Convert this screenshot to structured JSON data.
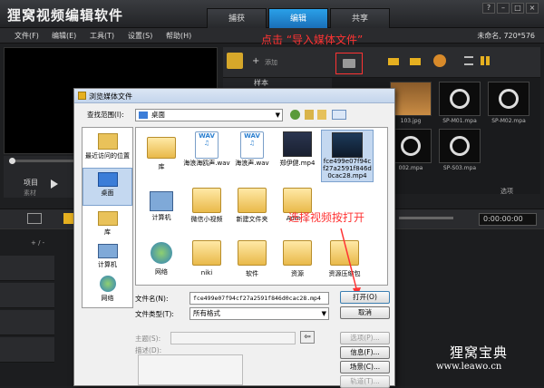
{
  "app": {
    "title": "狸窝视频编辑软件",
    "modes": [
      "捕获",
      "编辑",
      "共享"
    ],
    "active_mode": "编辑",
    "project_info": "未命名, 720*576"
  },
  "menu": [
    "文件(F)",
    "编辑(E)",
    "工具(T)",
    "设置(S)",
    "帮助(H)"
  ],
  "library": {
    "add_label": "添加",
    "sample_label": "样本",
    "options_label": "选项",
    "thumbs": [
      {
        "label": "103.jpg",
        "kind": "image"
      },
      {
        "label": "SP-M01.mpa",
        "kind": "audio"
      },
      {
        "label": "SP-M02.mpa",
        "kind": "audio"
      },
      {
        "label": "002.mpa",
        "kind": "audio"
      },
      {
        "label": "SP-S03.mpa",
        "kind": "audio"
      }
    ]
  },
  "player": {
    "project_label": "项目",
    "clip_label": "素材",
    "timecode": "0:00:00:00"
  },
  "timeline": {
    "timecode": "0:00:00:00",
    "ruler_label": "+ / -"
  },
  "dialog": {
    "title": "浏览媒体文件",
    "look_in_label": "查找范围(I):",
    "look_in_value": "桌面",
    "places": [
      "最近访问的位置",
      "桌面",
      "库",
      "计算机",
      "网络"
    ],
    "files": [
      {
        "name": "库",
        "type": "folder"
      },
      {
        "name": "海浪海鸥声.wav",
        "type": "wav"
      },
      {
        "name": "海浪声.wav",
        "type": "wav"
      },
      {
        "name": "郑伊健.mp4",
        "type": "video"
      },
      {
        "name": "fce499e07f94cf27a2591f846d0cac28.mp4",
        "type": "video-selected"
      },
      {
        "name": "计算机",
        "type": "computer"
      },
      {
        "name": "微信小视频",
        "type": "folder"
      },
      {
        "name": "新建文件夹",
        "type": "folder"
      },
      {
        "name": "Admi...",
        "type": "user"
      },
      {
        "name": "网络",
        "type": "network"
      },
      {
        "name": "niki",
        "type": "folder"
      },
      {
        "name": "软件",
        "type": "folder"
      },
      {
        "name": "资源",
        "type": "folder"
      },
      {
        "name": "资源压缩包",
        "type": "folder"
      }
    ],
    "filename_label": "文件名(N):",
    "filename_value": "fce499e07f94cf27a2591f846d0cac28.mp4",
    "filetype_label": "文件类型(T):",
    "filetype_value": "所有格式",
    "open_button": "打开(O)",
    "cancel_button": "取消",
    "subject_label": "主题(S):",
    "description_label": "描述(D):",
    "options_button": "选项(P)...",
    "info_button": "信息(F)...",
    "scene_button": "场景(C)...",
    "trim_button": "轨道(T)..."
  },
  "annotations": {
    "import_hint": "点击 “导入媒体文件”",
    "select_hint": "选择视频按打开"
  },
  "watermark": {
    "name": "狸窝宝典",
    "url": "www.leawo.cn"
  },
  "colors": {
    "accent": "#1a8ad8",
    "annotation": "#ff3333",
    "dialog_bg": "#f0f0f0"
  }
}
